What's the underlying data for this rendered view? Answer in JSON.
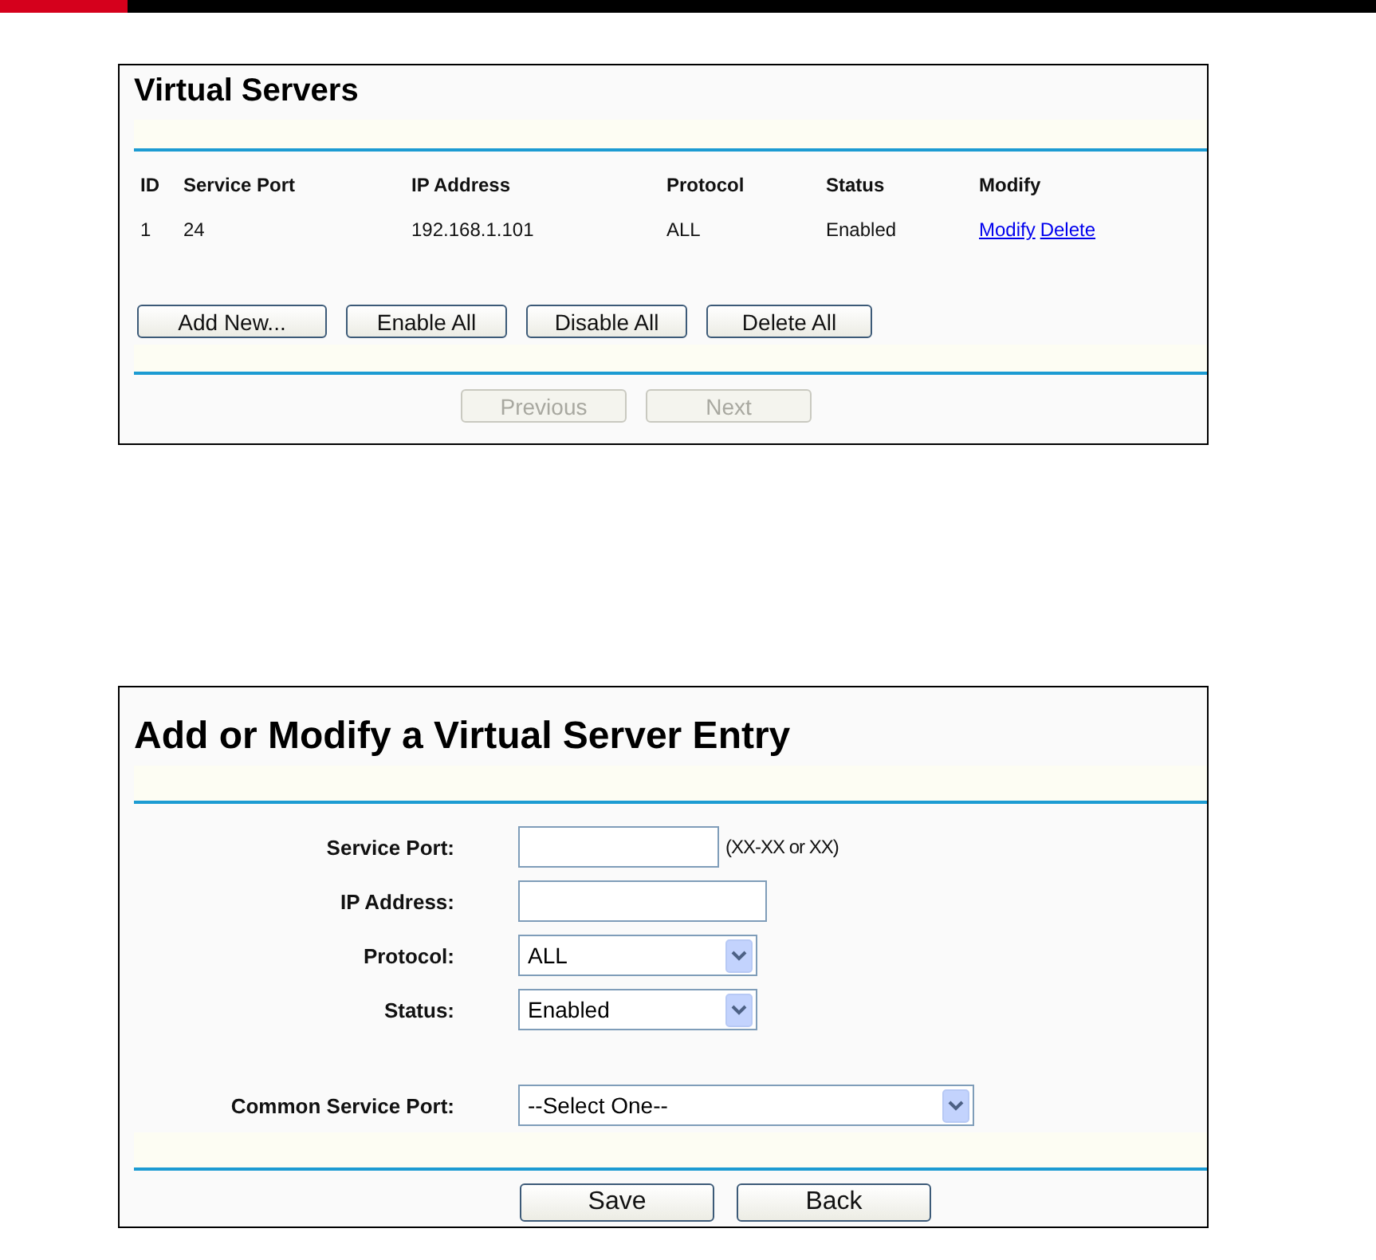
{
  "virtual_servers": {
    "title": "Virtual Servers",
    "table": {
      "columns": [
        "ID",
        "Service Port",
        "IP Address",
        "Protocol",
        "Status",
        "Modify"
      ],
      "rows": [
        {
          "cells": [
            "1",
            "24",
            "192.168.1.101",
            "ALL",
            "Enabled"
          ],
          "links": [
            "Modify",
            "Delete"
          ]
        }
      ]
    },
    "buttons": [
      {
        "label": "Add New...",
        "disabled": false
      },
      {
        "label": "Enable All",
        "disabled": false
      },
      {
        "label": "Disable All",
        "disabled": false
      },
      {
        "label": "Delete All",
        "disabled": false
      }
    ],
    "pager": [
      {
        "label": "Previous",
        "disabled": true
      },
      {
        "label": "Next",
        "disabled": true
      }
    ]
  },
  "entry_form": {
    "title": "Add or Modify a Virtual Server Entry",
    "fields": [
      {
        "kind": "text",
        "label": "Service Port:",
        "hint": "(XX-XX or XX)"
      },
      {
        "kind": "text",
        "label": "IP Address:"
      },
      {
        "kind": "select",
        "label": "Protocol:",
        "value": "ALL"
      },
      {
        "kind": "select",
        "label": "Status:",
        "value": "Enabled"
      },
      {
        "kind": "select",
        "label": "Common Service Port:",
        "value": "--Select One--"
      }
    ],
    "buttons": [
      {
        "label": "Save",
        "disabled": false
      },
      {
        "label": "Back",
        "disabled": false
      }
    ]
  }
}
